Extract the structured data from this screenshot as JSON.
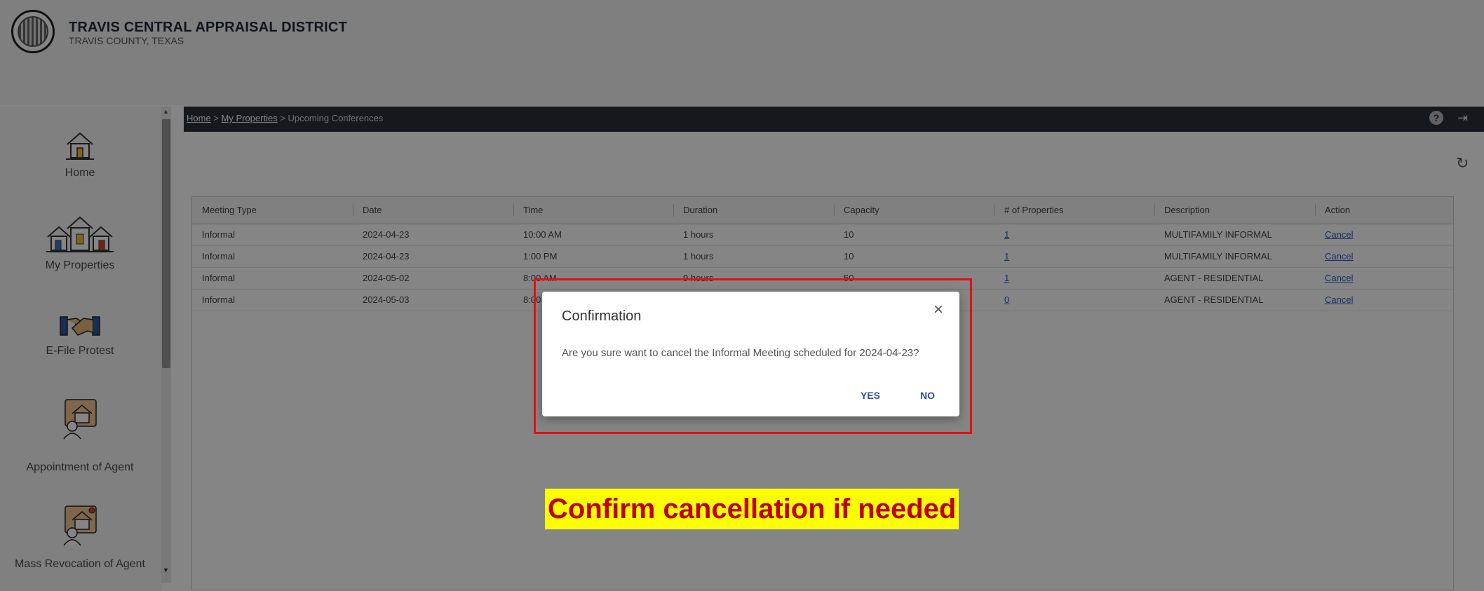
{
  "header": {
    "org_name": "TRAVIS CENTRAL APPRAISAL DISTRICT",
    "org_sub": "TRAVIS COUNTY, TEXAS"
  },
  "sidebar": {
    "items": [
      {
        "label": "Home",
        "icon": "home-icon"
      },
      {
        "label": "My Properties",
        "icon": "properties-icon"
      },
      {
        "label": "E-File Protest",
        "icon": "handshake-icon"
      },
      {
        "label": "Appointment of Agent",
        "icon": "agent-icon"
      },
      {
        "label": "Mass Revocation of Agent",
        "icon": "revocation-icon"
      }
    ]
  },
  "breadcrumb": {
    "home": "Home",
    "sep1": " > ",
    "properties": "My Properties",
    "sep2": " > ",
    "current": "Upcoming Conferences"
  },
  "table": {
    "headers": [
      "Meeting Type",
      "Date",
      "Time",
      "Duration",
      "Capacity",
      "# of Properties",
      "Description",
      "Action"
    ],
    "rows": [
      [
        "Informal",
        "2024-04-23",
        "10:00 AM",
        "1 hours",
        "10",
        "1",
        "MULTIFAMILY INFORMAL",
        "Cancel"
      ],
      [
        "Informal",
        "2024-04-23",
        "1:00 PM",
        "1 hours",
        "10",
        "1",
        "MULTIFAMILY INFORMAL",
        "Cancel"
      ],
      [
        "Informal",
        "2024-05-02",
        "8:00 AM",
        "9 hours",
        "50",
        "1",
        "AGENT - RESIDENTIAL",
        "Cancel"
      ],
      [
        "Informal",
        "2024-05-03",
        "8:00 AM",
        "",
        "",
        "0",
        "AGENT - RESIDENTIAL",
        "Cancel"
      ]
    ]
  },
  "dialog": {
    "title": "Confirmation",
    "close": "×",
    "message": "Are you sure want to cancel the Informal Meeting scheduled for 2024-04-23?",
    "yes": "YES",
    "no": "NO"
  },
  "annotation": "Confirm cancellation if needed",
  "icons": {
    "help": "?",
    "logout": "⇥",
    "refresh": "↻"
  },
  "colors": {
    "accent": "#2b4da8",
    "annotation_bg": "#ffff00",
    "annotation_text": "#c00000",
    "highlight": "#e11212"
  }
}
